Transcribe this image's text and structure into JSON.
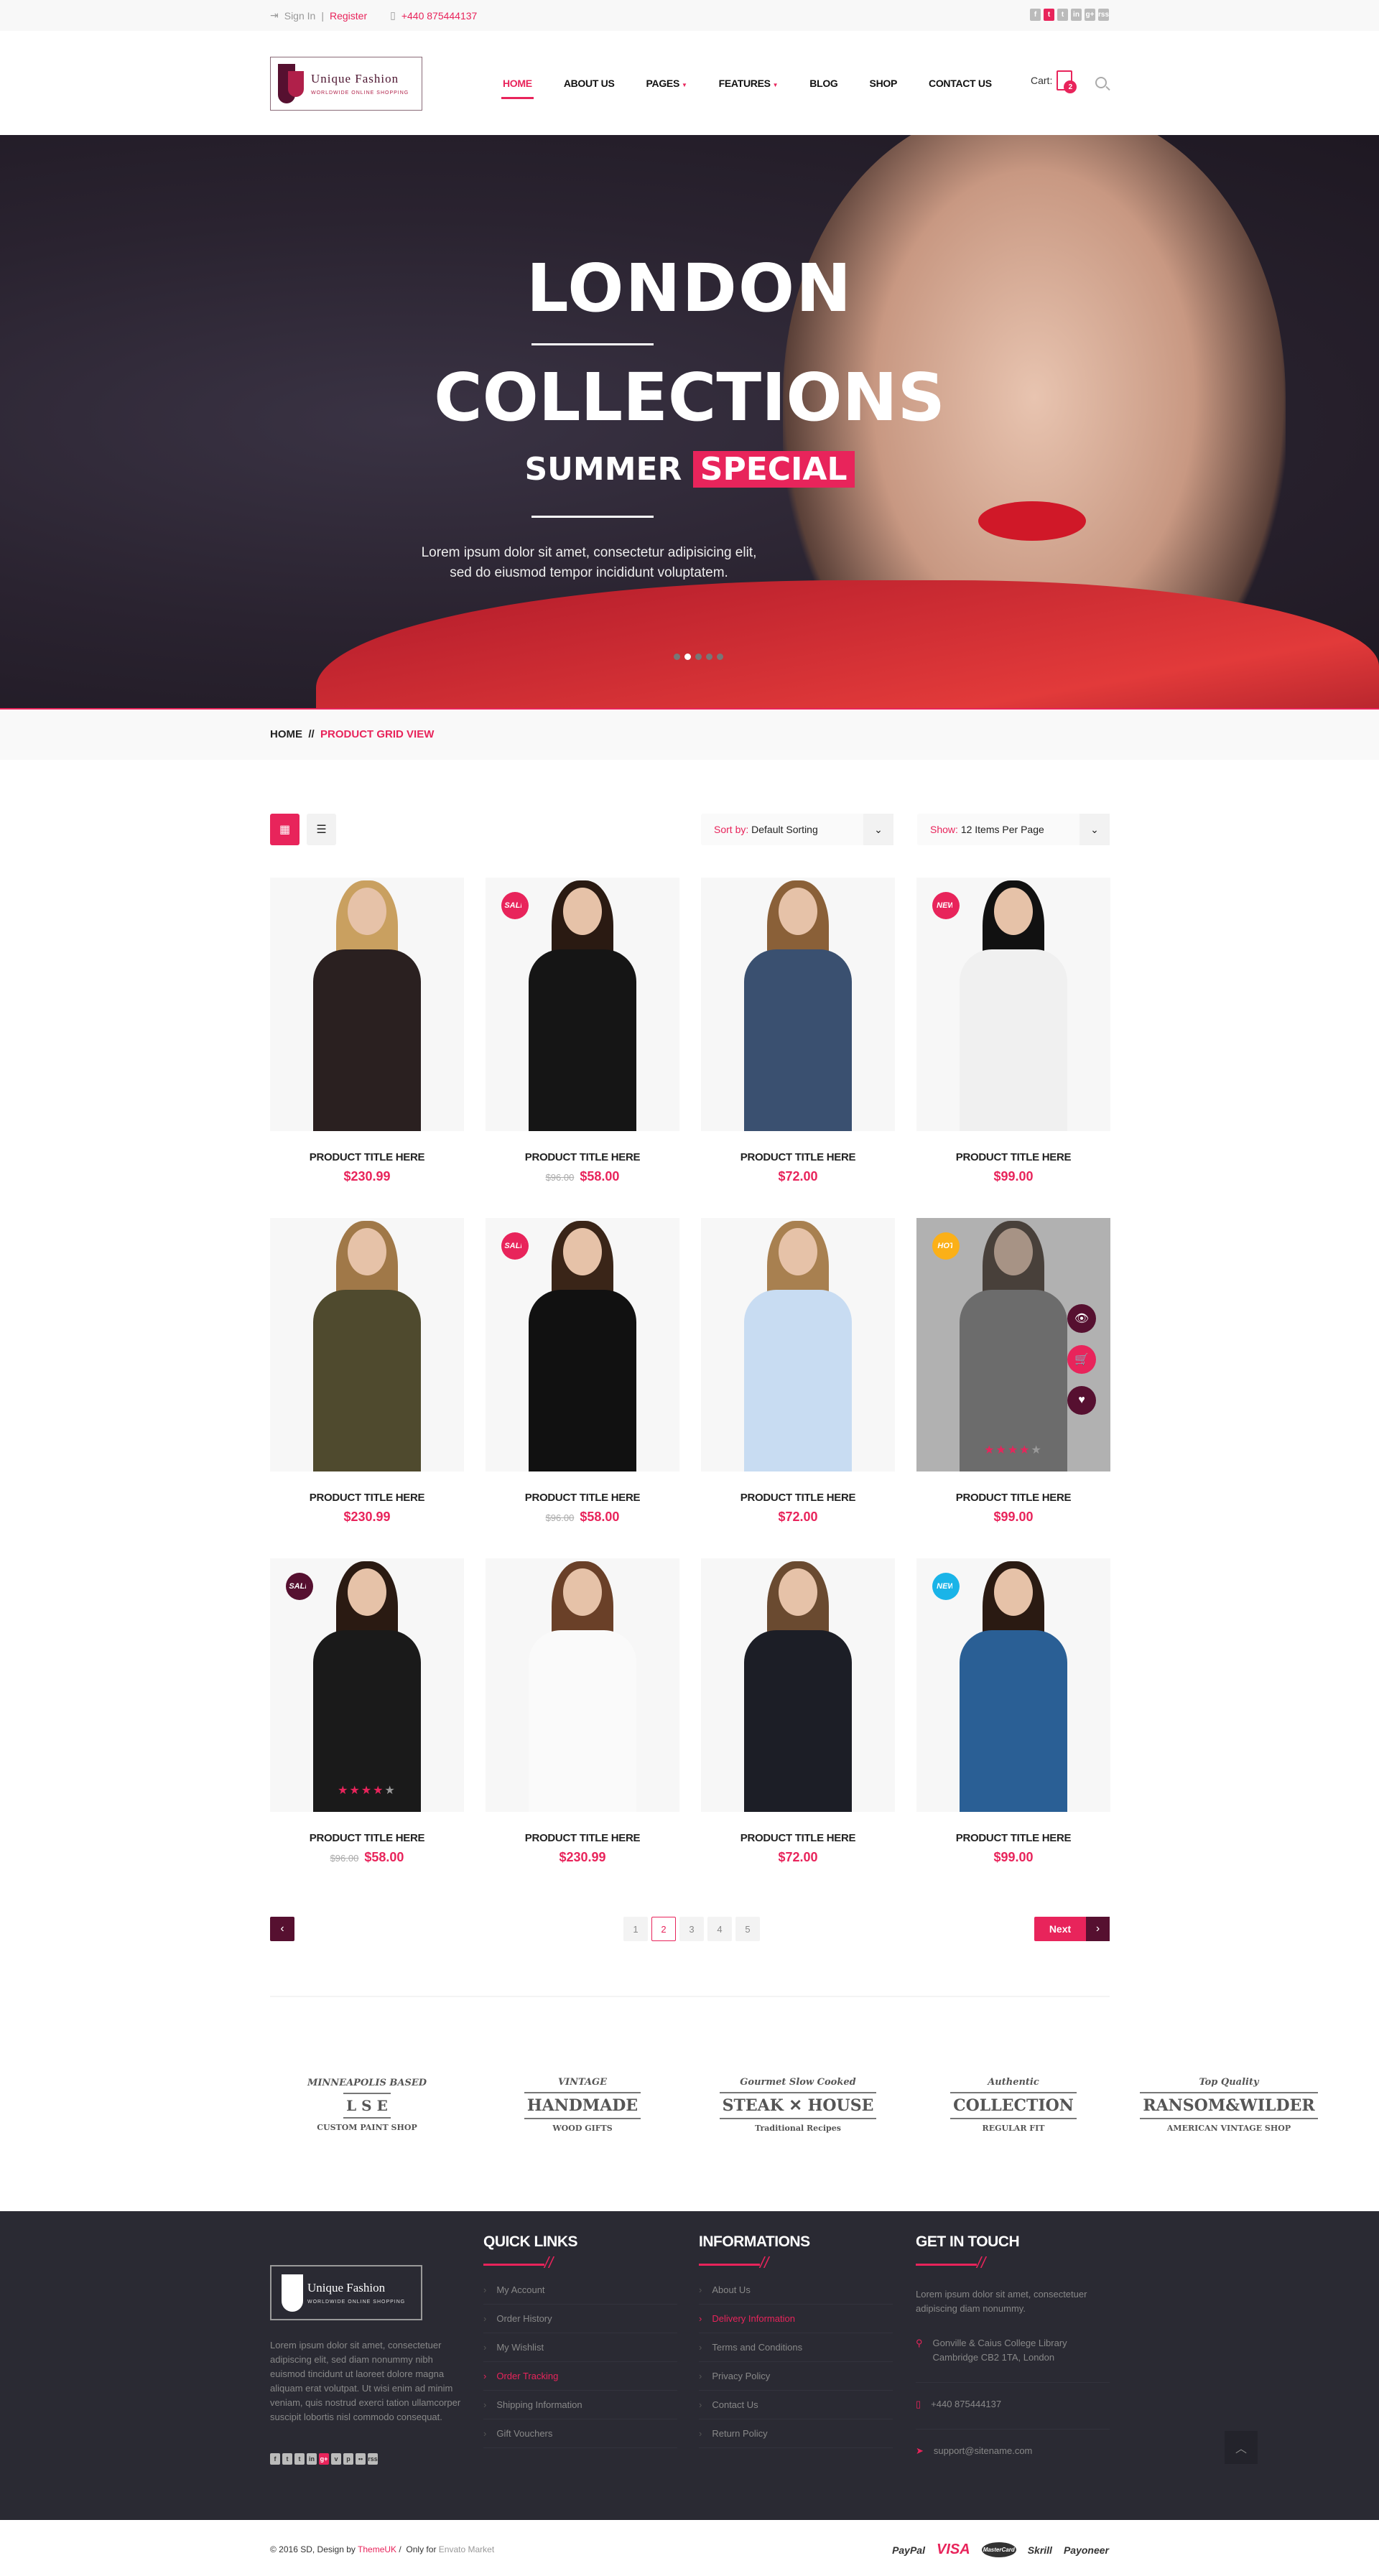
{
  "colors": {
    "accent": "#e8245b",
    "maroon": "#561030",
    "footer_bg": "#2a2a33",
    "hot": "#fbb018",
    "new_cyan": "#1ab4e8"
  },
  "topbar": {
    "signin": "Sign In",
    "register": "Register",
    "phone": "+440 875444137",
    "social": [
      "f",
      "t",
      "t",
      "in",
      "g+",
      "rss"
    ]
  },
  "logo": {
    "name": "Unique Fashion",
    "tagline": "WORLDWIDE ONLINE SHOPPING"
  },
  "nav": {
    "items": [
      {
        "label": "HOME",
        "active": true
      },
      {
        "label": "ABOUT US"
      },
      {
        "label": "PAGES",
        "dropdown": true
      },
      {
        "label": "FEATURES",
        "dropdown": true
      },
      {
        "label": "BLOG"
      },
      {
        "label": "SHOP"
      },
      {
        "label": "CONTACT US"
      }
    ],
    "cart_label": "Cart:",
    "cart_count": "2"
  },
  "hero": {
    "line1": "LONDON",
    "line2": "COLLECTIONS",
    "line3a": "SUMMER",
    "line3b": "SPECIAL",
    "text1": "Lorem ipsum dolor sit amet, consectetur adipisicing elit,",
    "text2": "sed do eiusmod tempor incididunt voluptatem.",
    "slides": 5,
    "active_slide": 2
  },
  "breadcrumb": {
    "home": "HOME",
    "sep": "//",
    "current": "PRODUCT GRID VIEW"
  },
  "toolbar": {
    "sort_label": "Sort by:",
    "sort_value": "Default Sorting",
    "show_label": "Show:",
    "show_value": "12 Items Per Page"
  },
  "products": [
    {
      "title": "PRODUCT TITLE HERE",
      "price": "$230.99",
      "body": "#2a2020",
      "hair": "#c9a060"
    },
    {
      "title": "PRODUCT TITLE HERE",
      "old": "$96.00",
      "price": "$58.00",
      "badge": "SALE",
      "badge_color": "#e8245b",
      "body": "#151515",
      "hair": "#2a1a12"
    },
    {
      "title": "PRODUCT TITLE HERE",
      "price": "$72.00",
      "body": "#3a5070",
      "hair": "#8a6038"
    },
    {
      "title": "PRODUCT TITLE HERE",
      "price": "$99.00",
      "badge": "NEW",
      "badge_color": "#e8245b",
      "body": "#f0f0f0",
      "hair": "#111"
    },
    {
      "title": "PRODUCT TITLE HERE",
      "price": "$230.99",
      "body": "#4f4a2e",
      "hair": "#a07848"
    },
    {
      "title": "PRODUCT TITLE HERE",
      "old": "$96.00",
      "price": "$58.00",
      "badge": "SALE",
      "badge_color": "#e8245b",
      "body": "#111",
      "hair": "#3a2518"
    },
    {
      "title": "PRODUCT TITLE HERE",
      "price": "$72.00",
      "body": "#c8dcf2",
      "hair": "#a88050"
    },
    {
      "title": "PRODUCT TITLE HERE",
      "price": "$99.00",
      "badge": "HOT",
      "badge_color": "#fbb018",
      "body": "#7a7a7a",
      "hair": "#3a2a20",
      "hover": true,
      "rating": 4
    },
    {
      "title": "PRODUCT TITLE HERE",
      "old": "$96.00",
      "price": "$58.00",
      "badge": "SALE",
      "badge_color": "#561030",
      "body": "#1a1a1a",
      "hair": "#2a1a12",
      "rating": 4
    },
    {
      "title": "PRODUCT TITLE HERE",
      "price": "$230.99",
      "body": "#fafafa",
      "hair": "#6a4028"
    },
    {
      "title": "PRODUCT TITLE HERE",
      "price": "$72.00",
      "body": "#1c1e26",
      "hair": "#6a4a30"
    },
    {
      "title": "PRODUCT TITLE HERE",
      "price": "$99.00",
      "badge": "NEW",
      "badge_color": "#1ab4e8",
      "body": "#2a5f95",
      "hair": "#2a1a12"
    }
  ],
  "pagination": {
    "pages": [
      "1",
      "2",
      "3",
      "4",
      "5"
    ],
    "current": "2",
    "next": "Next"
  },
  "brands": [
    {
      "l1": "MINNEAPOLIS BASED",
      "l2": "L S E",
      "l3": "CUSTOM PAINT SHOP"
    },
    {
      "l1": "VINTAGE",
      "l2": "HANDMADE",
      "l3": "WOOD GIFTS"
    },
    {
      "l1": "Gourmet Slow Cooked",
      "l2": "STEAK ✕ HOUSE",
      "l3": "Traditional Recipes"
    },
    {
      "l1": "Authentic",
      "l2": "COLLECTION",
      "l3": "REGULAR FIT"
    },
    {
      "l1": "Top Quality",
      "l2": "RANSOM&WILDER",
      "l3": "AMERICAN VINTAGE SHOP"
    }
  ],
  "footer": {
    "about": "Lorem ipsum dolor sit amet, consectetuer adipiscing elit, sed diam nonummy nibh euismod tincidunt ut laoreet dolore magna aliquam erat volutpat. Ut wisi enim ad minim veniam, quis nostrud exerci tation ullamcorper suscipit lobortis nisl commodo consequat.",
    "social": [
      "f",
      "t",
      "t",
      "in",
      "g+",
      "v",
      "p",
      "••",
      "rss"
    ],
    "quick_title": "QUICK LINKS",
    "quick": [
      "My Account",
      "Order History",
      "My Wishlist",
      "Order Tracking",
      "Shipping Information",
      "Gift Vouchers"
    ],
    "info_title": "INFORMATIONS",
    "info": [
      "About Us",
      "Delivery Information",
      "Terms and Conditions",
      "Privacy Policy",
      "Contact Us",
      "Return Policy"
    ],
    "touch_title": "GET IN TOUCH",
    "touch_text": "Lorem ipsum dolor sit amet, consectetuer adipiscing diam nonummy.",
    "address1": "Gonville & Caius College Library",
    "address2": "Cambridge CB2 1TA, London",
    "phone": "+440 875444137",
    "email": "support@sitename.com"
  },
  "bottom": {
    "copy": "© 2016 SD, Design by",
    "designer": "ThemeUK",
    "sep": "/",
    "only": "Only for",
    "market": "Envato Market",
    "payments": [
      "PayPal",
      "VISA",
      "MasterCard",
      "Skrill",
      "Payoneer"
    ]
  }
}
